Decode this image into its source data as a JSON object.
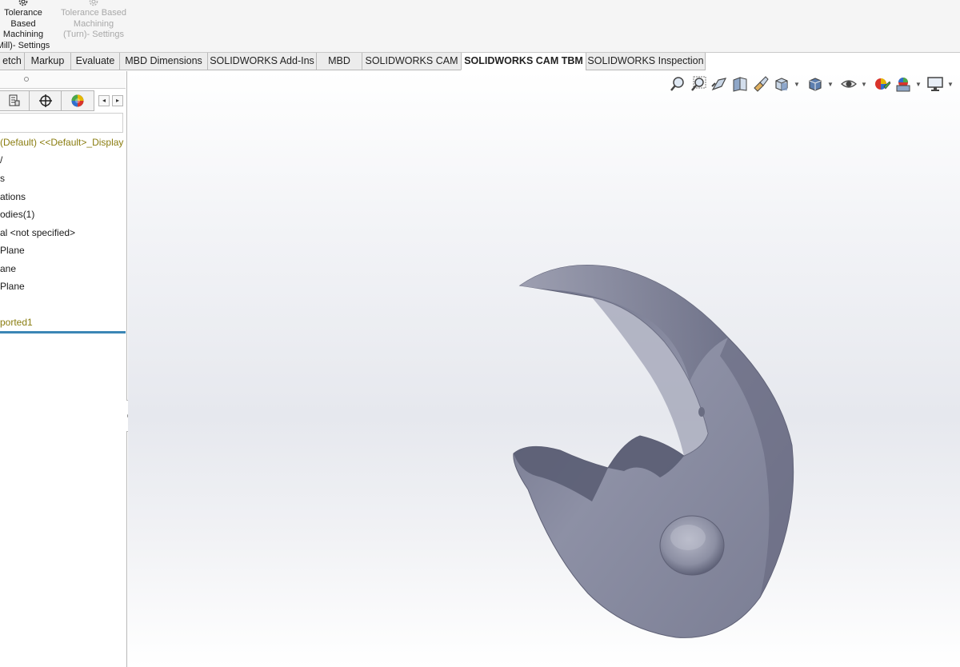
{
  "ribbon": {
    "buttons": [
      {
        "lines": [
          "Tolerance",
          "Based",
          "Machining",
          "Mill)- Settings"
        ],
        "icon": "gear-icon",
        "enabled": true
      },
      {
        "lines": [
          "Tolerance Based",
          "Machining",
          "(Turn)- Settings"
        ],
        "icon": "gear-icon",
        "enabled": false
      }
    ]
  },
  "tabs": [
    {
      "label": "etch"
    },
    {
      "label": "Markup"
    },
    {
      "label": "Evaluate"
    },
    {
      "label": "MBD Dimensions"
    },
    {
      "label": "SOLIDWORKS Add-Ins"
    },
    {
      "label": "MBD"
    },
    {
      "label": "SOLIDWORKS CAM"
    },
    {
      "label": "SOLIDWORKS CAM TBM",
      "active": true
    },
    {
      "label": "SOLIDWORKS Inspection"
    }
  ],
  "panel": {
    "toolbar_icons": [
      "property-manager-icon",
      "configuration-manager-icon",
      "display-manager-icon"
    ],
    "tree": [
      {
        "label": "(Default) <<Default>_Display",
        "color": "olive"
      },
      {
        "label": "/"
      },
      {
        "label": "s"
      },
      {
        "label": "ations"
      },
      {
        "label": "odies(1)"
      },
      {
        "label": "al <not specified>"
      },
      {
        "label": "Plane"
      },
      {
        "label": "ane"
      },
      {
        "label": "Plane"
      },
      {
        "label": ""
      },
      {
        "label": "ported1",
        "color": "olive"
      }
    ]
  },
  "hud": {
    "icons": [
      "zoom-to-fit-icon",
      "zoom-to-area-icon",
      "previous-view-icon",
      "section-view-icon",
      "dynamic-annotation-icon",
      "view-orientation-icon",
      "display-style-icon",
      "hide-show-icon",
      "edit-appearance-icon",
      "apply-scene-icon",
      "view-settings-icon"
    ]
  },
  "colors": {
    "accent": "#3b86b5",
    "model": "#8c8fa3",
    "tree_olive": "#8a7d10"
  }
}
